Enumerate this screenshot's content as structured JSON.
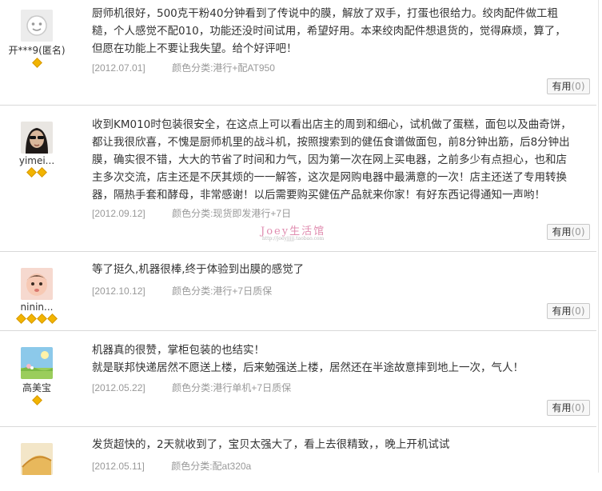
{
  "reviews": [
    {
      "user": "开***9(匿名)",
      "level": 1,
      "avatar_icon": "default-face-icon",
      "lines": [
        "厨师机很好，500克干粉40分钟看到了传说中的膜，解放了双手，打蛋也很给力。绞肉配件做工粗",
        "糙，个人感觉不配010，功能还没时间试用，希望好用。本来绞肉配件想退货的，觉得麻烦，算了，",
        "但愿在功能上不要让我失望。给个好评吧！"
      ],
      "date": "[2012.07.01]",
      "spec": "颜色分类:港行+配AT950",
      "useful_label": "有用",
      "useful_count": "(0)"
    },
    {
      "user": "yimei...",
      "level": 2,
      "avatar_icon": "woman-sunglasses-avatar-icon",
      "lines": [
        "收到KM010时包装很安全，在这点上可以看出店主的周到和细心，试机做了蛋糕，面包以及曲奇饼，",
        "都让我很欣喜，不愧是厨师机里的战斗机，按照搜索到的健伍食谱做面包，前8分钟出筋，后8分钟出",
        "膜，确实很不错，大大的节省了时间和力气，因为第一次在网上买电器，之前多少有点担心，也和店",
        "主多次交流，店主还是不厌其烦的一一解答，这次是网购电器中最满意的一次！店主还送了专用转换",
        "器，隔热手套和酵母，非常感谢！以后需要购买健伍产品就来你家！有好东西记得通知一声哟！"
      ],
      "date": "[2012.09.12]",
      "spec": "颜色分类:现货即发港行+7日",
      "useful_label": "有用",
      "useful_count": "(0)"
    },
    {
      "user": "ninin...",
      "level": 4,
      "avatar_icon": "baby-avatar-icon",
      "lines": [
        "等了挺久,机器很棒,终于体验到出膜的感觉了"
      ],
      "date": "[2012.10.12]",
      "spec": "颜色分类:港行+7日质保",
      "useful_label": "有用",
      "useful_count": "(0)"
    },
    {
      "user": "高美宝",
      "level": 1,
      "avatar_icon": "landscape-avatar-icon",
      "lines": [
        "机器真的很赞，掌柜包装的也结实！",
        "就是联邦快递居然不愿送上楼，后来勉强送上楼，居然还在半途故意摔到地上一次，气人！"
      ],
      "date": "[2012.05.22]",
      "spec": "颜色分类:港行单机+7日质保",
      "useful_label": "有用",
      "useful_count": "(0)"
    },
    {
      "user": "",
      "level": 0,
      "avatar_icon": "cake-avatar-icon",
      "lines": [
        "发货超快的，2天就收到了，宝贝太强大了，看上去很精致，，晚上开机试试"
      ],
      "date": "[2012.05.11]",
      "spec": "颜色分类:配at320a",
      "useful_label": "",
      "useful_count": ""
    }
  ],
  "watermark": {
    "text": "Joey生活馆",
    "url": "http://joeyjjjjj.taobao.com"
  }
}
